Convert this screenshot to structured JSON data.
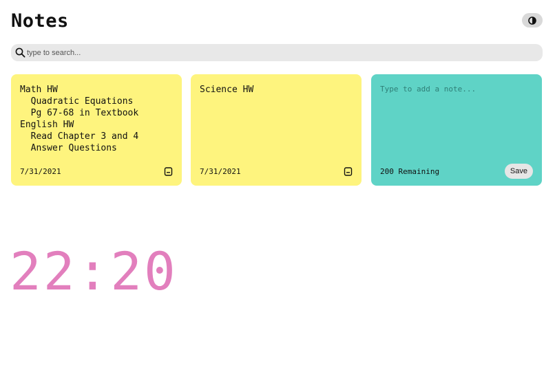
{
  "header": {
    "title": "Notes",
    "theme_toggle_icon": "contrast-icon"
  },
  "search": {
    "placeholder": "type to search...",
    "value": "",
    "icon": "search-icon"
  },
  "notes": [
    {
      "text": "Math HW\n  Quadratic Equations\n  Pg 67-68 in Textbook\nEnglish HW\n  Read Chapter 3 and 4\n  Answer Questions",
      "date": "7/31/2021",
      "color": "#fef47e",
      "delete_icon": "delete-note-icon"
    },
    {
      "text": "Science HW",
      "date": "7/31/2021",
      "color": "#fef47e",
      "delete_icon": "delete-note-icon"
    }
  ],
  "new_note": {
    "placeholder": "Type to add a note...",
    "value": "",
    "remaining_text": "200 Remaining",
    "save_label": "Save",
    "color": "#5fd3c6"
  },
  "clock": {
    "time": "22:20",
    "color": "#e27fbd"
  }
}
